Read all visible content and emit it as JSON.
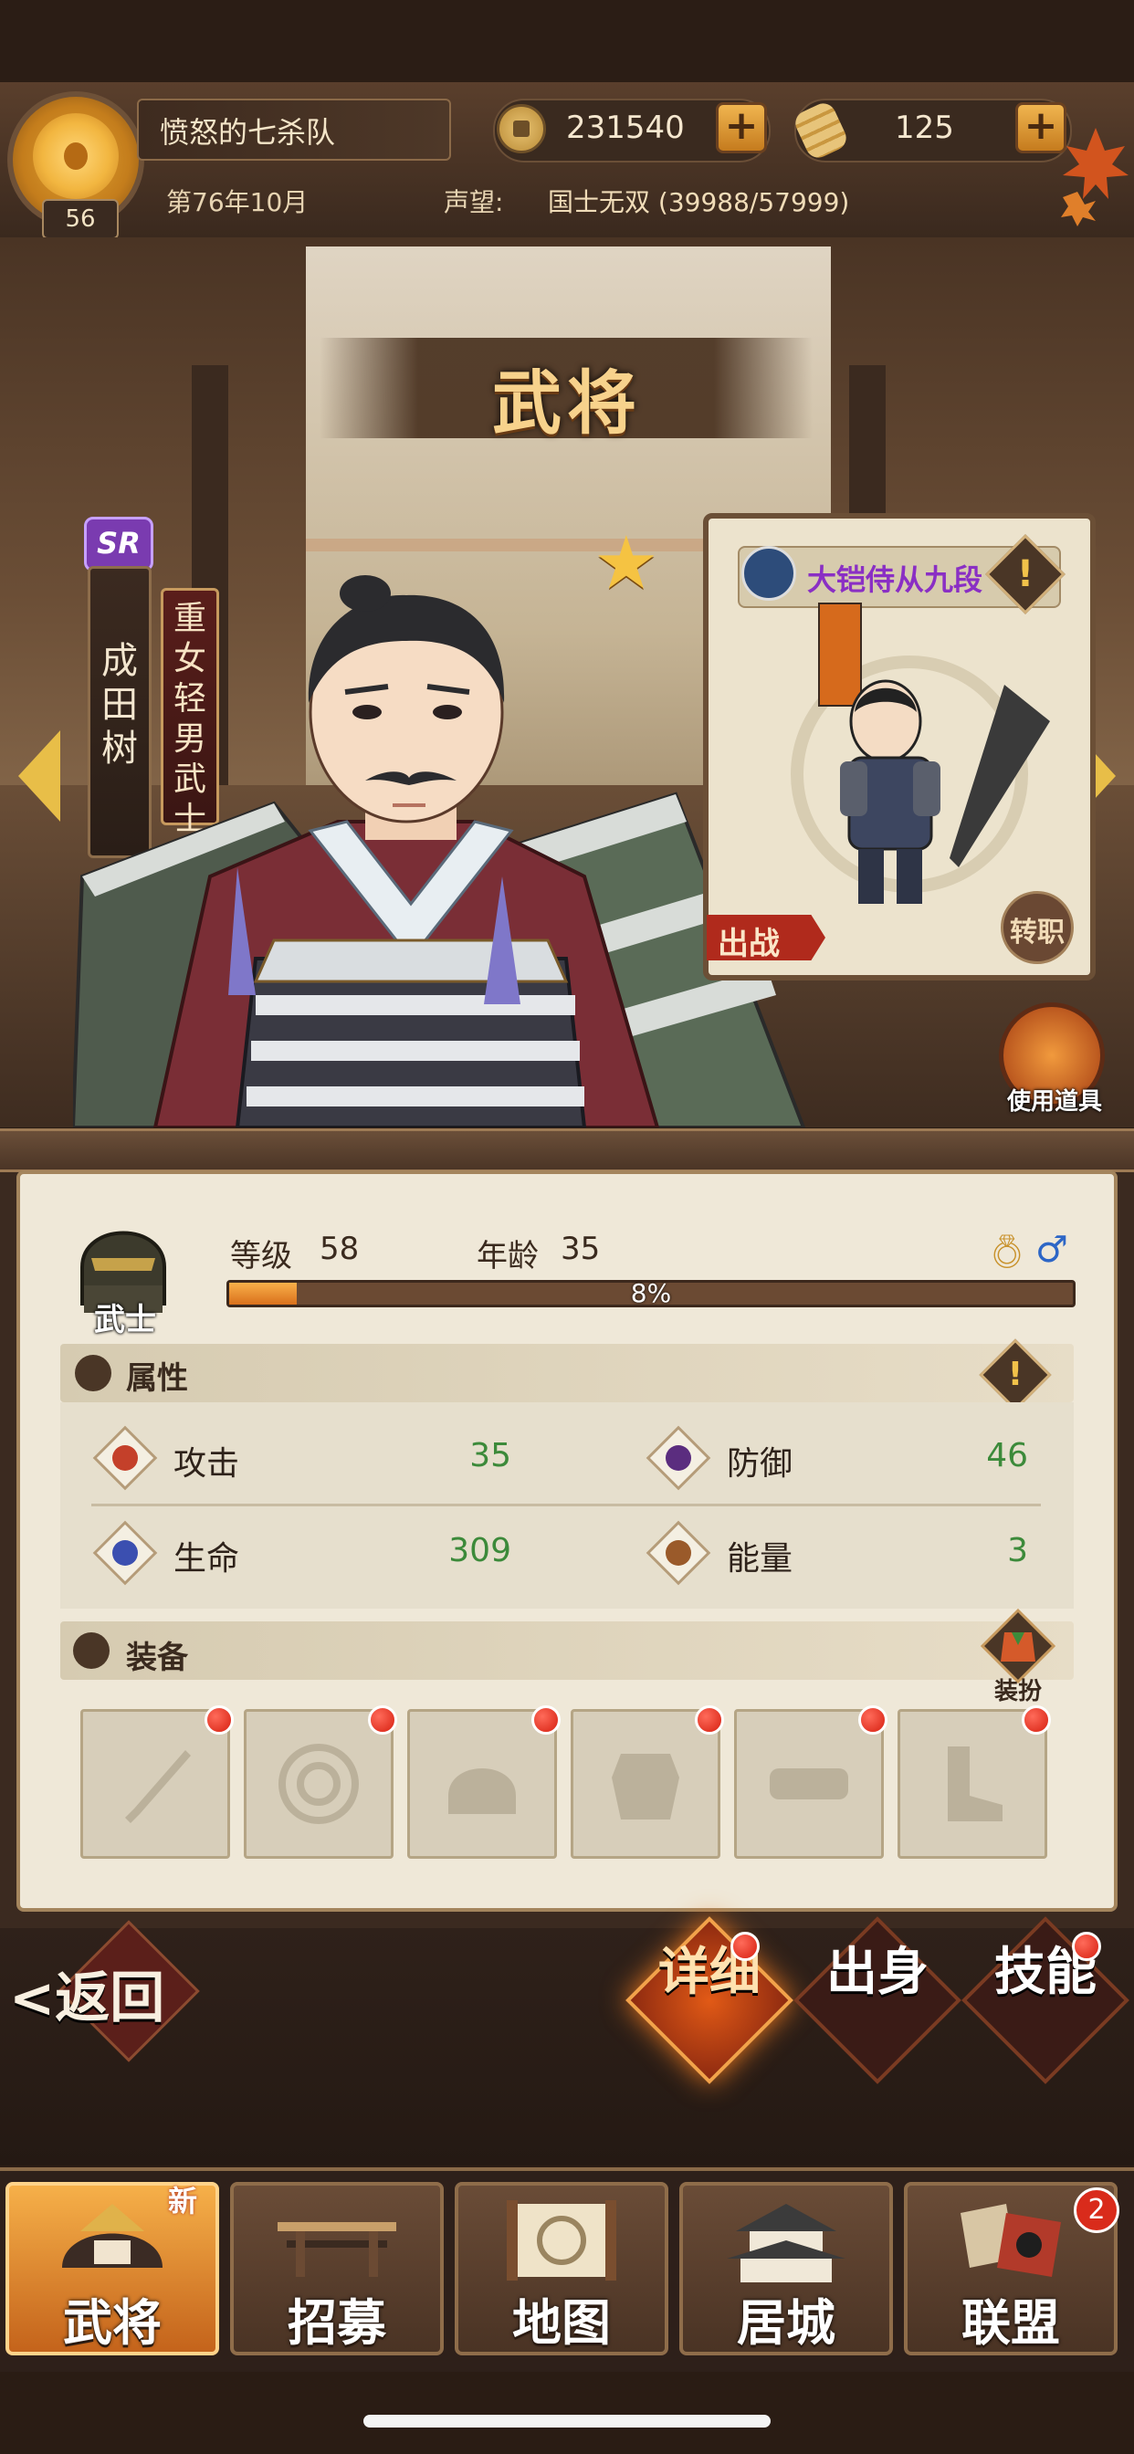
{
  "header": {
    "player_level": "56",
    "team_name": "愤怒的七杀队",
    "coins": "231540",
    "gold_bars": "125",
    "date": "第76年10月",
    "reputation_label": "声望:",
    "reputation_value": "国士无双 (39988/57999)"
  },
  "scene": {
    "title": "武将"
  },
  "hero": {
    "rarity": "SR",
    "name": "成田树",
    "trait": "重女轻男武士",
    "class_label": "武士",
    "level_label": "等级",
    "level": "58",
    "age_label": "年龄",
    "age": "35",
    "xp_percent": 8,
    "xp_text": "8%"
  },
  "unit_card": {
    "rank": "大铠侍从九段",
    "deploy_label": "出战",
    "transfer_label": "转职"
  },
  "use_item_label": "使用道具",
  "attributes": {
    "section_title": "属性",
    "stats": [
      {
        "label": "攻击",
        "value": "35",
        "icon": "attack-icon"
      },
      {
        "label": "防御",
        "value": "46",
        "icon": "defense-icon"
      },
      {
        "label": "生命",
        "value": "309",
        "icon": "health-icon"
      },
      {
        "label": "能量",
        "value": "3",
        "icon": "energy-icon"
      }
    ]
  },
  "equipment": {
    "section_title": "装备",
    "outfit_label": "装扮",
    "slots": [
      "weapon-slot",
      "shield-slot",
      "helmet-slot",
      "armor-slot",
      "belt-slot",
      "boots-slot"
    ]
  },
  "tabs": {
    "back_label": "返回",
    "detail": "详细",
    "origin": "出身",
    "skill": "技能"
  },
  "nav": {
    "items": [
      {
        "label": "武将",
        "active": true
      },
      {
        "label": "招募"
      },
      {
        "label": "地图"
      },
      {
        "label": "居城"
      },
      {
        "label": "联盟"
      }
    ],
    "new_tag": "新",
    "alliance_badge": "2"
  },
  "colors": {
    "accent_orange": "#d9701b",
    "stat_green": "#3c8a3a",
    "rank_purple": "#8a2fc4",
    "badge_red": "#d92b1b"
  }
}
